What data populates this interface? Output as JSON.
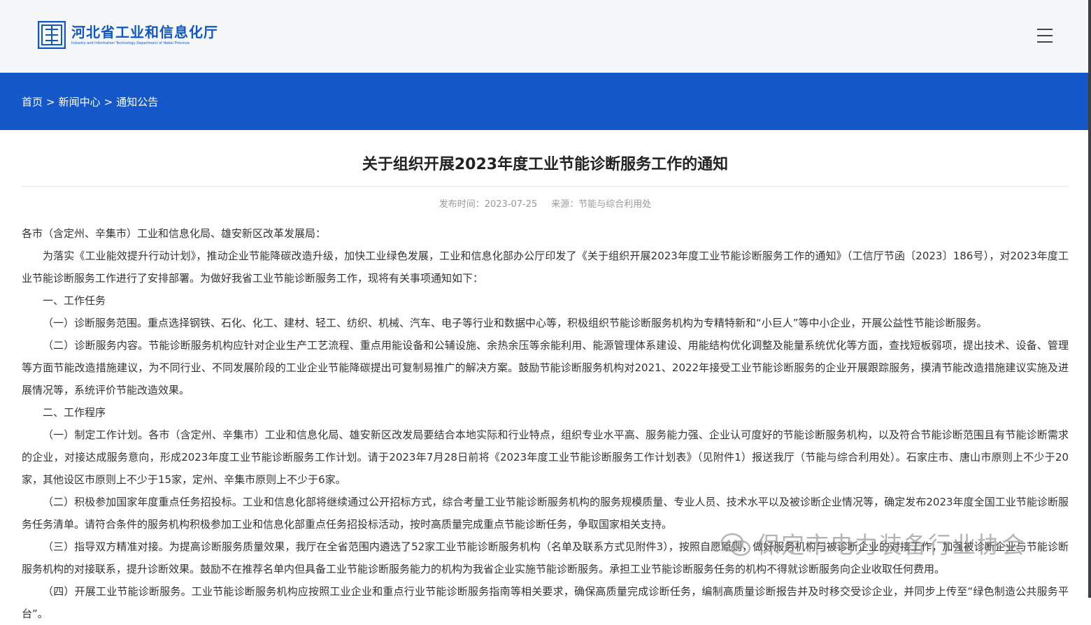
{
  "site": {
    "name_cn": "河北省工业和信息化厅",
    "name_en": "Industry and Information Technology Department of Hebei Province"
  },
  "breadcrumb": {
    "home": "首页",
    "news": "新闻中心",
    "current": "通知公告",
    "separator": ">"
  },
  "article": {
    "title": "关于组织开展2023年度工业节能诊断服务工作的通知",
    "publish_time": "发布时间：2023-07-25",
    "source": "来源：节能与综合利用处",
    "paragraphs": [
      "各市（含定州、辛集市）工业和信息化局、雄安新区改革发展局：",
      "为落实《工业能效提升行动计划》，推动企业节能降碳改造升级，加快工业绿色发展，工业和信息化部办公厅印发了《关于组织开展2023年度工业节能诊断服务工作的通知》（工信厅节函〔2023〕186号），对2023年度工业节能诊断服务工作进行了安排部署。为做好我省工业节能诊断服务工作，现将有关事项通知如下：",
      "一、工作任务",
      "（一）诊断服务范围。重点选择钢铁、石化、化工、建材、轻工、纺织、机械、汽车、电子等行业和数据中心等，积极组织节能诊断服务机构为专精特新和“小巨人”等中小企业，开展公益性节能诊断服务。",
      "（二）诊断服务内容。节能诊断服务机构应针对企业生产工艺流程、重点用能设备和公辅设施、余热余压等余能利用、能源管理体系建设、用能结构优化调整及能量系统优化等方面，查找短板弱项，提出技术、设备、管理等方面节能改造措施建议，为不同行业、不同发展阶段的工业企业节能降碳提出可复制易推广的解决方案。鼓励节能诊断服务机构对2021、2022年接受工业节能诊断服务的企业开展跟踪服务，摸清节能改造措施建议实施及进展情况等，系统评价节能改造效果。",
      "二、工作程序",
      "（一）制定工作计划。各市（含定州、辛集市）工业和信息化局、雄安新区改发局要结合本地实际和行业特点，组织专业水平高、服务能力强、企业认可度好的节能诊断服务机构，以及符合节能诊断范围且有节能诊断需求的企业，对接达成服务意向，形成2023年度工业节能诊断服务工作计划。请于2023年7月28日前将《2023年度工业节能诊断服务工作计划表》（见附件1）报送我厅（节能与综合利用处）。石家庄市、唐山市原则上不少于20家，其他设区市原则上不少于15家，定州、辛集市原则上不少于6家。",
      "（二）积极参加国家年度重点任务招投标。工业和信息化部将继续通过公开招标方式，综合考量工业节能诊断服务机构的服务规模质量、专业人员、技术水平以及被诊断企业情况等，确定发布2023年度全国工业节能诊断服务任务清单。请符合条件的服务机构积极参加工业和信息化部重点任务招投标活动，按时高质量完成重点节能诊断任务，争取国家相关支持。",
      "（三）指导双方精准对接。为提高诊断服务质量效果，我厅在全省范围内遴选了52家工业节能诊断服务机构（名单及联系方式见附件3），按照自愿原则，做好服务机构与被诊断企业的对接工作，加强被诊断企业与节能诊断服务机构的对接联系，提升诊断效果。鼓励不在推荐名单内但具备工业节能诊断服务能力的机构为我省企业实施节能诊断服务。承担工业节能诊断服务任务的机构不得就诊断服务向企业收取任何费用。",
      "（四）开展工业节能诊断服务。工业节能诊断服务机构应按照工业企业和重点行业节能诊断服务指南等相关要求，确保高质量完成诊断任务，编制高质量诊断报告并及时移交受诊企业，并同步上传至“绿色制造公共服务平台”。"
    ]
  },
  "watermark": {
    "text": "保定市电力装备行业协会",
    "icon": "wechat-icon"
  },
  "colors": {
    "brand": "#1157c4",
    "band": "#1457c8",
    "header_bg": "#f6f7f9",
    "meta_text": "#999999"
  }
}
